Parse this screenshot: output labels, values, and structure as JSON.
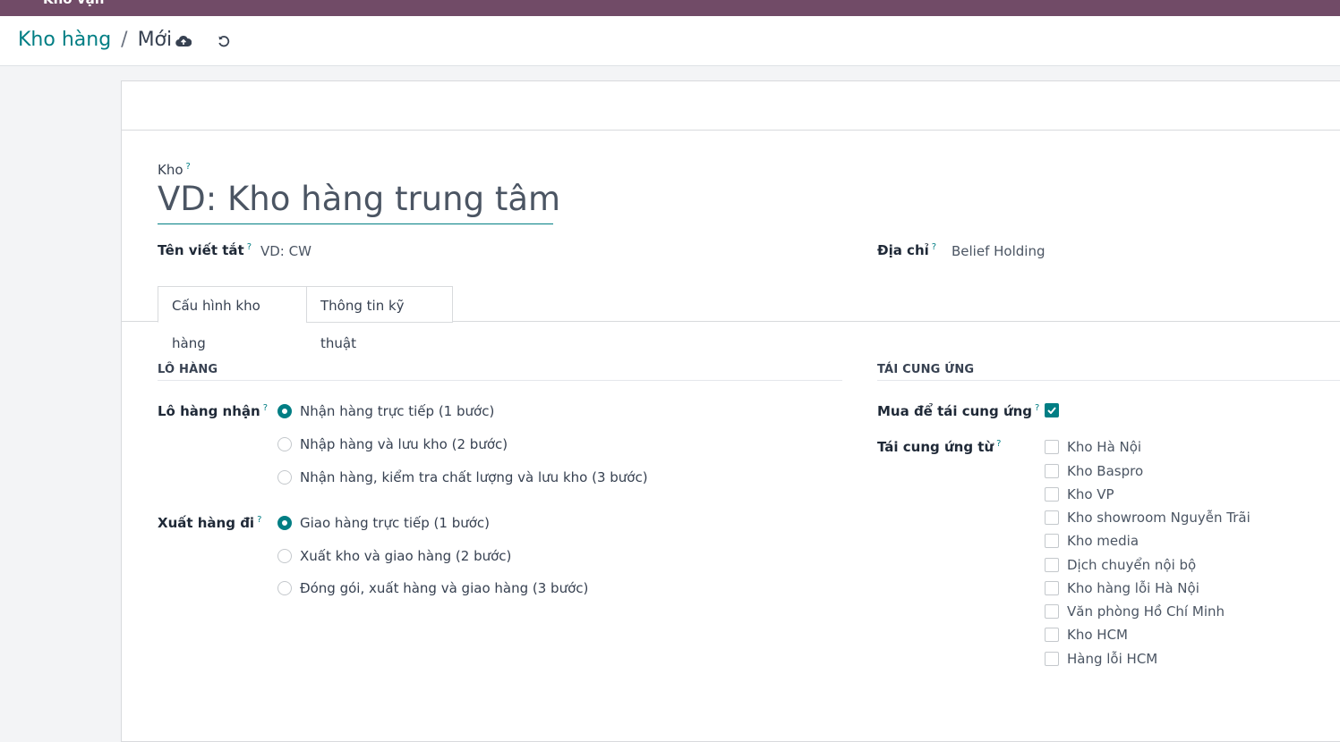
{
  "topbar": {
    "app_name": "Kho vận"
  },
  "breadcrumb": {
    "parent": "Kho hàng",
    "separator": "/",
    "current": "Mới"
  },
  "form": {
    "name_label": "Kho",
    "help_mark": "?",
    "name_placeholder": "VD: Kho hàng trung tâm",
    "code_label": "Tên viết tắt",
    "code_placeholder": "VD: CW",
    "address_label": "Địa chỉ",
    "address_value": "Belief Holding"
  },
  "tabs": [
    {
      "label": "Cấu hình kho hàng",
      "active": true
    },
    {
      "label": "Thông tin kỹ thuật",
      "active": false
    }
  ],
  "shipments": {
    "section_title": "LÔ HÀNG",
    "incoming_label": "Lô hàng nhận",
    "incoming_options": [
      {
        "label": "Nhận hàng trực tiếp (1 bước)",
        "selected": true
      },
      {
        "label": "Nhập hàng và lưu kho (2 bước)",
        "selected": false
      },
      {
        "label": "Nhận hàng, kiểm tra chất lượng và lưu kho (3 bước)",
        "selected": false
      }
    ],
    "outgoing_label": "Xuất hàng đi",
    "outgoing_options": [
      {
        "label": "Giao hàng trực tiếp (1 bước)",
        "selected": true
      },
      {
        "label": "Xuất kho và giao hàng (2 bước)",
        "selected": false
      },
      {
        "label": "Đóng gói, xuất hàng và giao hàng (3 bước)",
        "selected": false
      }
    ]
  },
  "resupply": {
    "section_title": "TÁI CUNG ỨNG",
    "buy_label": "Mua để tái cung ứng",
    "buy_checked": true,
    "from_label": "Tái cung ứng từ",
    "warehouses": [
      {
        "label": "Kho Hà Nội",
        "checked": false
      },
      {
        "label": "Kho Baspro",
        "checked": false
      },
      {
        "label": "Kho VP",
        "checked": false
      },
      {
        "label": "Kho showroom Nguyễn Trãi",
        "checked": false
      },
      {
        "label": "Kho media",
        "checked": false
      },
      {
        "label": "Dịch chuyển nội bộ",
        "checked": false
      },
      {
        "label": "Kho hàng lỗi Hà Nội",
        "checked": false
      },
      {
        "label": "Văn phòng Hồ Chí Minh",
        "checked": false
      },
      {
        "label": "Kho HCM",
        "checked": false
      },
      {
        "label": "Hàng lỗi HCM",
        "checked": false
      }
    ]
  },
  "colors": {
    "brand": "#714B67",
    "accent": "#017e84"
  }
}
